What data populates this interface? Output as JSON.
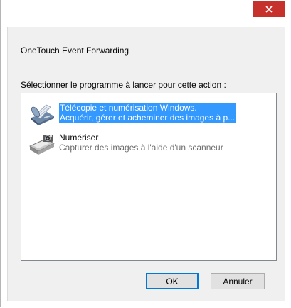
{
  "window": {
    "close_icon": "close-icon"
  },
  "dialog": {
    "device_name": "OneTouch Event Forwarding",
    "prompt": "Sélectionner le programme à lancer pour cette action :",
    "items": [
      {
        "name": "Télécopie et numérisation Windows.",
        "description": "Acquérir, gérer et acheminer des images à p...",
        "icon": "fax-scanner-icon",
        "selected": true
      },
      {
        "name": "Numériser",
        "description": "Capturer des images à l'aide d'un scanneur",
        "icon": "scanner-camera-icon",
        "selected": false
      }
    ],
    "ok_label": "OK",
    "cancel_label": "Annuler"
  },
  "colors": {
    "close_button": "#c7312b",
    "selection": "#3399ff",
    "client_background": "#f0f0f0",
    "default_button_border": "#0078d7"
  }
}
